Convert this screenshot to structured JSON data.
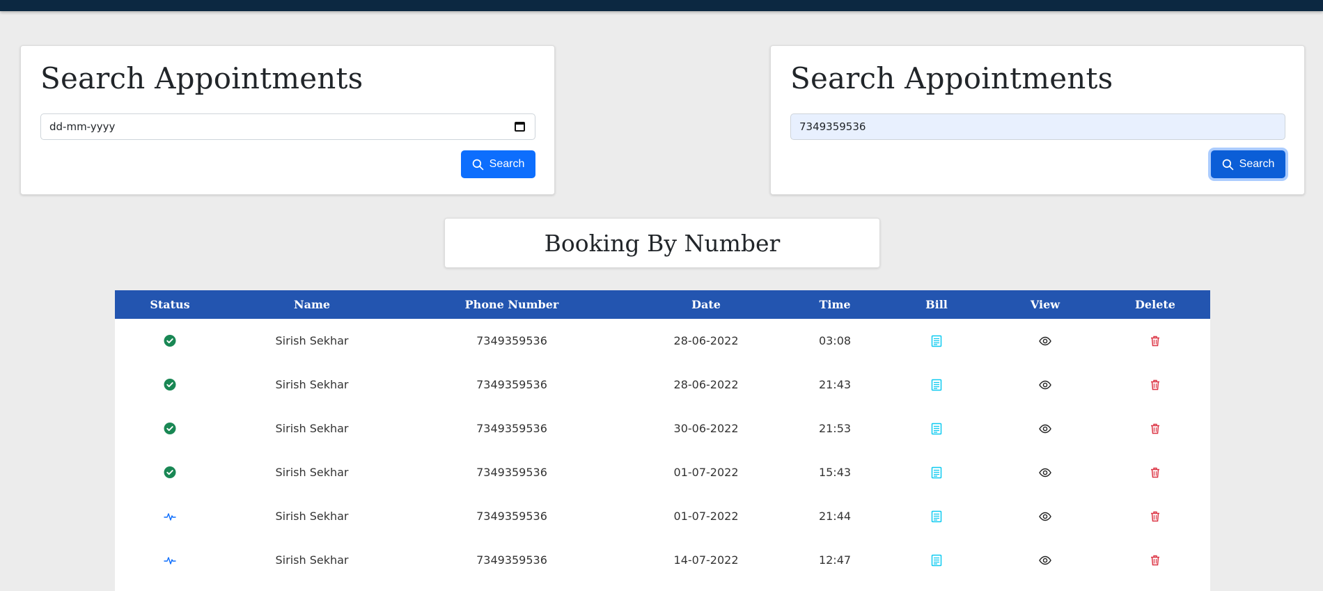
{
  "left_panel": {
    "title": "Search Appointments",
    "date_placeholder": "dd-mm-yyyy",
    "search_label": "Search"
  },
  "right_panel": {
    "title": "Search Appointments",
    "phone_value": "7349359536",
    "search_label": "Search"
  },
  "section_title": "Booking By Number",
  "table": {
    "headers": {
      "status": "Status",
      "name": "Name",
      "phone": "Phone Number",
      "date": "Date",
      "time": "Time",
      "bill": "Bill",
      "view": "View",
      "delete": "Delete"
    },
    "rows": [
      {
        "status": "completed",
        "name": "Sirish Sekhar",
        "phone": "7349359536",
        "date": "28-06-2022",
        "time": "03:08"
      },
      {
        "status": "completed",
        "name": "Sirish Sekhar",
        "phone": "7349359536",
        "date": "28-06-2022",
        "time": "21:43"
      },
      {
        "status": "completed",
        "name": "Sirish Sekhar",
        "phone": "7349359536",
        "date": "30-06-2022",
        "time": "21:53"
      },
      {
        "status": "completed",
        "name": "Sirish Sekhar",
        "phone": "7349359536",
        "date": "01-07-2022",
        "time": "15:43"
      },
      {
        "status": "active",
        "name": "Sirish Sekhar",
        "phone": "7349359536",
        "date": "01-07-2022",
        "time": "21:44"
      },
      {
        "status": "active",
        "name": "Sirish Sekhar",
        "phone": "7349359536",
        "date": "14-07-2022",
        "time": "12:47"
      }
    ]
  },
  "colors": {
    "header_bg": "#2355b0",
    "topbar": "#0c2841",
    "primary": "#0d6efd",
    "success": "#198754",
    "bill": "#0dcaf0",
    "danger": "#dc3545"
  }
}
